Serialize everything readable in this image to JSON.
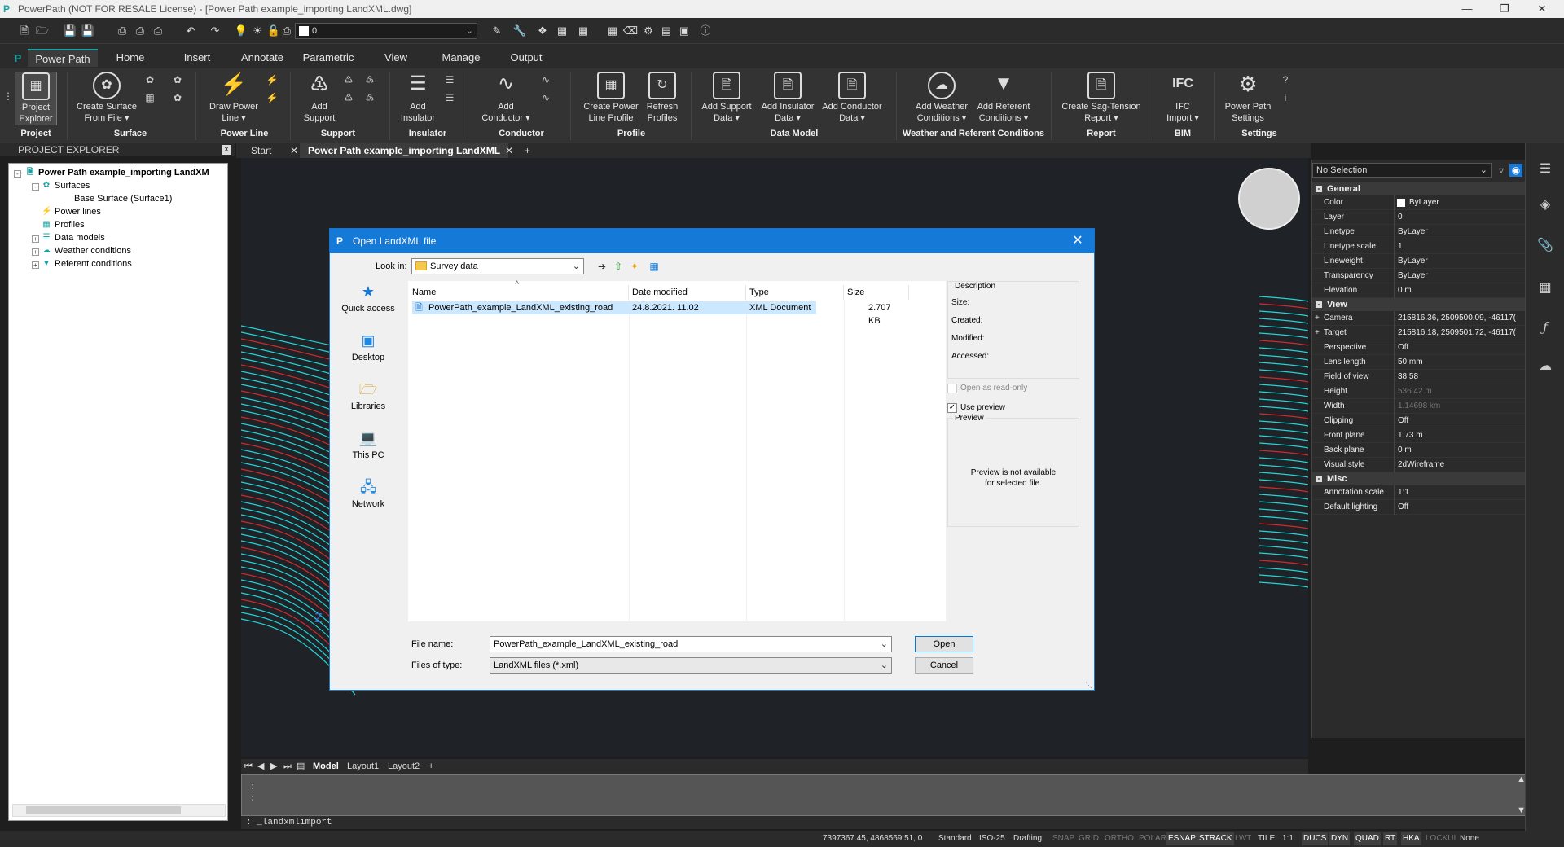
{
  "app": {
    "window_title": "PowerPath (NOT FOR RESALE License) - [Power Path example_importing LandXML.dwg]",
    "logo": "P"
  },
  "qat": {
    "layer_value": "0"
  },
  "tabs": [
    "Power Path",
    "Home",
    "Insert",
    "Annotate",
    "Parametric",
    "View",
    "Manage",
    "Output"
  ],
  "ribbon": {
    "buttons": [
      {
        "label": "Project\nExplorer",
        "line1": "Project",
        "line2": "Explorer"
      },
      {
        "line1": "Create Surface",
        "line2": "From File ▾"
      },
      {
        "line1": "Draw Power",
        "line2": "Line ▾"
      },
      {
        "line1": "Add",
        "line2": "Support"
      },
      {
        "line1": "Add",
        "line2": "Insulator"
      },
      {
        "line1": "Add",
        "line2": "Conductor ▾"
      },
      {
        "line1": "Create Power",
        "line2": "Line Profile"
      },
      {
        "line1": "Refresh",
        "line2": "Profiles"
      },
      {
        "line1": "Add Support",
        "line2": "Data ▾"
      },
      {
        "line1": "Add Insulator",
        "line2": "Data ▾"
      },
      {
        "line1": "Add Conductor",
        "line2": "Data ▾"
      },
      {
        "line1": "Add Weather",
        "line2": "Conditions ▾"
      },
      {
        "line1": "Add Referent",
        "line2": "Conditions ▾"
      },
      {
        "line1": "Create Sag-Tension",
        "line2": "Report ▾"
      },
      {
        "line1": "IFC",
        "line2": "Import ▾"
      },
      {
        "line1": "Power Path",
        "line2": "Settings"
      }
    ],
    "groups": [
      "Project",
      "Surface",
      "Power Line",
      "Support",
      "Insulator",
      "Conductor",
      "Profile",
      "Data Model",
      "Weather and Referent Conditions",
      "Report",
      "BIM",
      "Settings"
    ]
  },
  "project_explorer": {
    "header": "PROJECT EXPLORER",
    "close": "x",
    "root": "Power Path example_importing LandXM",
    "items": [
      "Surfaces",
      "Base Surface (Surface1)",
      "Power lines",
      "Profiles",
      "Data models",
      "Weather conditions",
      "Referent conditions"
    ]
  },
  "doc_tabs": {
    "start": "Start",
    "active": "Power Path example_importing LandXML",
    "add": "+"
  },
  "layout_tabs": [
    "Model",
    "Layout1",
    "Layout2",
    "+"
  ],
  "command": {
    "history": ":",
    "line": ": _landxmlimport"
  },
  "status": {
    "coords": "7397367.45, 4868569.51, 0",
    "items": [
      {
        "label": "Standard",
        "state": "text"
      },
      {
        "label": "ISO-25",
        "state": "text"
      },
      {
        "label": "Drafting",
        "state": "text"
      },
      {
        "label": "SNAP",
        "state": "off"
      },
      {
        "label": "GRID",
        "state": "off"
      },
      {
        "label": "ORTHO",
        "state": "off"
      },
      {
        "label": "POLAR",
        "state": "off"
      },
      {
        "label": "ESNAP",
        "state": "on"
      },
      {
        "label": "STRACK",
        "state": "on"
      },
      {
        "label": "LWT",
        "state": "off"
      },
      {
        "label": "TILE",
        "state": "text"
      },
      {
        "label": "1:1",
        "state": "text"
      },
      {
        "label": "DUCS",
        "state": "on"
      },
      {
        "label": "DYN",
        "state": "on"
      },
      {
        "label": "QUAD",
        "state": "on"
      },
      {
        "label": "RT",
        "state": "on"
      },
      {
        "label": "HKA",
        "state": "on"
      },
      {
        "label": "LOCKUI",
        "state": "off"
      },
      {
        "label": "None",
        "state": "text"
      }
    ]
  },
  "properties": {
    "selection": "No Selection",
    "sections": [
      {
        "title": "General",
        "rows": [
          {
            "k": "Color",
            "v": "ByLayer"
          },
          {
            "k": "Layer",
            "v": "0"
          },
          {
            "k": "Linetype",
            "v": "ByLayer"
          },
          {
            "k": "Linetype scale",
            "v": "1"
          },
          {
            "k": "Lineweight",
            "v": "ByLayer"
          },
          {
            "k": "Transparency",
            "v": "ByLayer"
          },
          {
            "k": "Elevation",
            "v": "0 m"
          }
        ]
      },
      {
        "title": "View",
        "rows": [
          {
            "k": "Camera",
            "v": "215816.36, 2509500.09, -46117("
          },
          {
            "k": "Target",
            "v": "215816.18, 2509501.72, -46117("
          },
          {
            "k": "Perspective",
            "v": "Off"
          },
          {
            "k": "Lens length",
            "v": "50 mm"
          },
          {
            "k": "Field of view",
            "v": "38.58"
          },
          {
            "k": "Height",
            "v": "536.42 m"
          },
          {
            "k": "Width",
            "v": "1.14698 km"
          },
          {
            "k": "Clipping",
            "v": "Off"
          },
          {
            "k": "Front plane",
            "v": "1.73 m"
          },
          {
            "k": "Back plane",
            "v": "0 m"
          },
          {
            "k": "Visual style",
            "v": "2dWireframe"
          }
        ]
      },
      {
        "title": "Misc",
        "rows": [
          {
            "k": "Annotation scale",
            "v": "1:1"
          },
          {
            "k": "Default lighting",
            "v": "Off"
          }
        ]
      }
    ]
  },
  "dialog": {
    "title": "Open LandXML file",
    "look_in_label": "Look in:",
    "look_in_value": "Survey data",
    "places": [
      "Quick access",
      "Desktop",
      "Libraries",
      "This PC",
      "Network"
    ],
    "columns": [
      "Name",
      "Date modified",
      "Type",
      "Size"
    ],
    "file": {
      "name": "PowerPath_example_LandXML_existing_road",
      "date": "24.8.2021. 11.02",
      "type": "XML Document",
      "size": "2.707 KB"
    },
    "description": {
      "title": "Description",
      "size": "Size:",
      "created": "Created:",
      "modified": "Modified:",
      "accessed": "Accessed:"
    },
    "open_read_only": "Open as read-only",
    "use_preview": "Use preview",
    "use_preview_checked": true,
    "preview_title": "Preview",
    "preview_msg1": "Preview is not available",
    "preview_msg2": "for selected file.",
    "file_name_label": "File name:",
    "file_name_value": "PowerPath_example_LandXML_existing_road",
    "files_of_type_label": "Files of type:",
    "files_of_type_value": "LandXML files (*.xml)",
    "open_button": "Open",
    "cancel_button": "Cancel"
  },
  "colors": {
    "accent": "#1ba1a1",
    "dialog_title": "#1579d8",
    "selection": "#cce8ff",
    "terrain_cyan": "#20d6d6",
    "terrain_red": "#d22a2a"
  }
}
